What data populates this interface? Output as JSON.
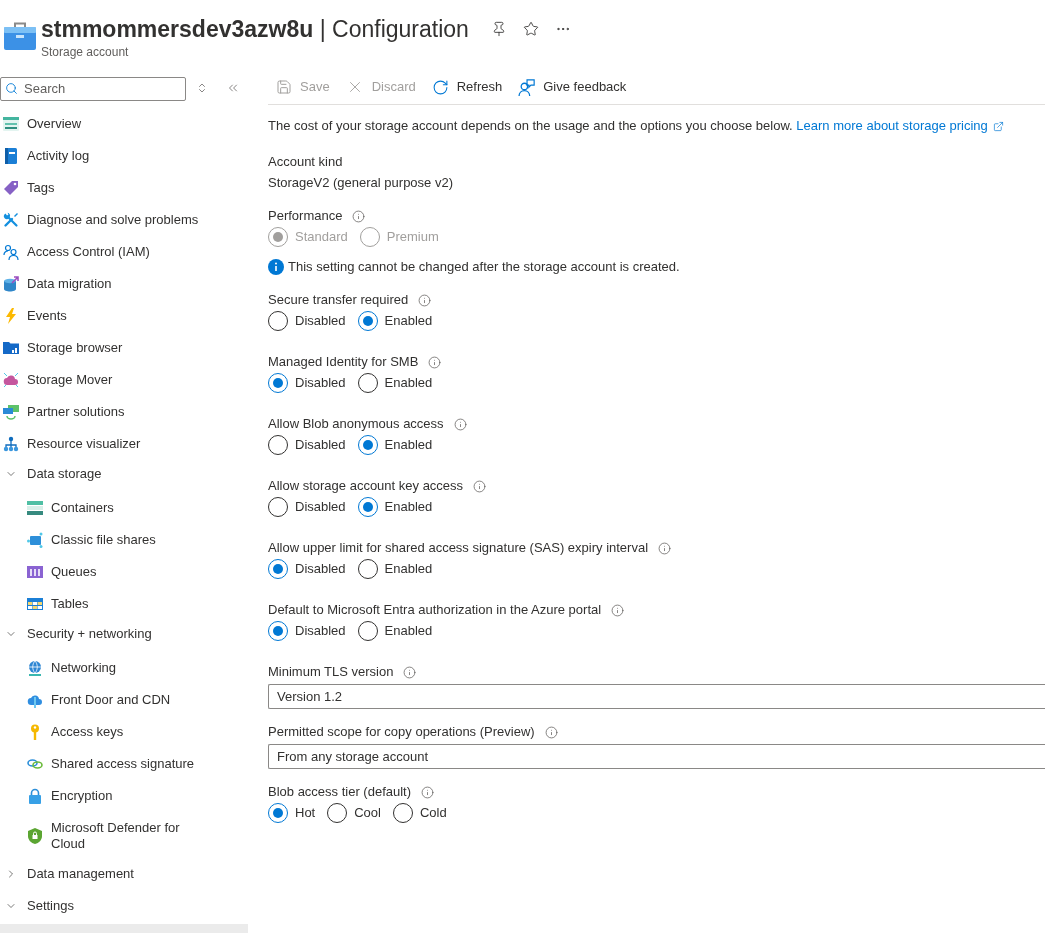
{
  "header": {
    "title": "**stmmommersdev3azw8u** | Configuration",
    "subtitle": "Storage account"
  },
  "sidebar": {
    "search": {
      "placeholder": "Search"
    },
    "items": [
      {
        "kind": "item",
        "label": "Overview",
        "selected": false
      },
      {
        "kind": "item",
        "label": "Activity log",
        "selected": false
      },
      {
        "kind": "item",
        "label": "Tags",
        "selected": false
      },
      {
        "kind": "item",
        "label": "Diagnose and solve problems",
        "selected": false
      },
      {
        "kind": "item",
        "label": "Access Control (IAM)",
        "selected": false
      },
      {
        "kind": "item",
        "label": "Data migration",
        "selected": false
      },
      {
        "kind": "item",
        "label": "Events",
        "selected": false
      },
      {
        "kind": "item",
        "label": "Storage browser",
        "selected": false
      },
      {
        "kind": "item",
        "label": "Storage Mover",
        "selected": false
      },
      {
        "kind": "item",
        "label": "Partner solutions",
        "selected": false
      },
      {
        "kind": "item",
        "label": "Resource visualizer",
        "selected": false
      },
      {
        "kind": "group",
        "label": "Data storage",
        "expanded": true,
        "children": [
          {
            "kind": "item",
            "label": "Containers",
            "selected": false
          },
          {
            "kind": "item",
            "label": "Classic file shares",
            "selected": false
          },
          {
            "kind": "item",
            "label": "Queues",
            "selected": false
          },
          {
            "kind": "item",
            "label": "Tables",
            "selected": false
          }
        ]
      },
      {
        "kind": "group",
        "label": "Security + networking",
        "expanded": true,
        "children": [
          {
            "kind": "item",
            "label": "Networking",
            "selected": false
          },
          {
            "kind": "item",
            "label": "Front Door and CDN",
            "selected": false
          },
          {
            "kind": "item",
            "label": "Access keys",
            "selected": false
          },
          {
            "kind": "item",
            "label": "Shared access signature",
            "selected": false
          },
          {
            "kind": "item",
            "label": "Encryption",
            "selected": false
          },
          {
            "kind": "item",
            "label": "Microsoft Defender for Cloud",
            "selected": false
          }
        ]
      },
      {
        "kind": "group",
        "label": "Data management",
        "expanded": false
      },
      {
        "kind": "group",
        "label": "Settings",
        "expanded": true,
        "children": [
          {
            "kind": "item",
            "selected": true
          }
        ]
      }
    ]
  },
  "toolbar": {
    "buttons": [
      {
        "label": "Save",
        "disabled": true
      },
      {
        "label": "Discard",
        "disabled": true
      },
      {
        "label": "Refresh",
        "disabled": false
      },
      {
        "label": "Give feedback",
        "disabled": false
      }
    ]
  },
  "intro": {
    "text": "The cost of your storage account depends on the usage and the options you choose below.",
    "link": "Learn more about storage pricing"
  },
  "settings": [
    {
      "kind": "text",
      "label": "Account kind",
      "value": "StorageV2 (general purpose v2)"
    },
    {
      "kind": "radio",
      "label": "Performance",
      "info": true,
      "disabled": true,
      "options": [
        {
          "label": "Standard",
          "selected": true
        },
        {
          "label": "Premium",
          "selected": false
        }
      ],
      "note": "This setting cannot be changed after the storage account is created."
    },
    {
      "kind": "radio",
      "label": "Secure transfer required",
      "info": true,
      "disabled": false,
      "options": [
        {
          "label": "Disabled",
          "selected": false
        },
        {
          "label": "Enabled",
          "selected": true
        }
      ]
    },
    {
      "kind": "radio",
      "label": "Managed Identity for SMB",
      "info": true,
      "disabled": false,
      "options": [
        {
          "label": "Disabled",
          "selected": true
        },
        {
          "label": "Enabled",
          "selected": false
        }
      ]
    },
    {
      "kind": "radio",
      "label": "Allow Blob anonymous access",
      "info": true,
      "disabled": false,
      "options": [
        {
          "label": "Disabled",
          "selected": false
        },
        {
          "label": "Enabled",
          "selected": true
        }
      ]
    },
    {
      "kind": "radio",
      "label": "Allow storage account key access",
      "info": true,
      "disabled": false,
      "options": [
        {
          "label": "Disabled",
          "selected": false
        },
        {
          "label": "Enabled",
          "selected": true
        }
      ]
    },
    {
      "kind": "radio",
      "label": "Allow upper limit for shared access signature (SAS) expiry interval",
      "info": true,
      "disabled": false,
      "options": [
        {
          "label": "Disabled",
          "selected": true
        },
        {
          "label": "Enabled",
          "selected": false
        }
      ]
    },
    {
      "kind": "radio",
      "label": "Default to Microsoft Entra authorization in the Azure portal",
      "info": true,
      "disabled": false,
      "options": [
        {
          "label": "Disabled",
          "selected": true
        },
        {
          "label": "Enabled",
          "selected": false
        }
      ]
    },
    {
      "kind": "dropdown",
      "label": "Minimum TLS version",
      "info": true,
      "value": "Version 1.2"
    },
    {
      "kind": "dropdown",
      "label": "Permitted scope for copy operations (Preview)",
      "info": true,
      "value": "From any storage account"
    },
    {
      "kind": "radio",
      "label": "Blob access tier (default)",
      "info": true,
      "disabled": false,
      "options": [
        {
          "label": "Hot",
          "selected": true
        },
        {
          "label": "Cool",
          "selected": false
        },
        {
          "label": "Cold",
          "selected": false
        }
      ]
    }
  ]
}
